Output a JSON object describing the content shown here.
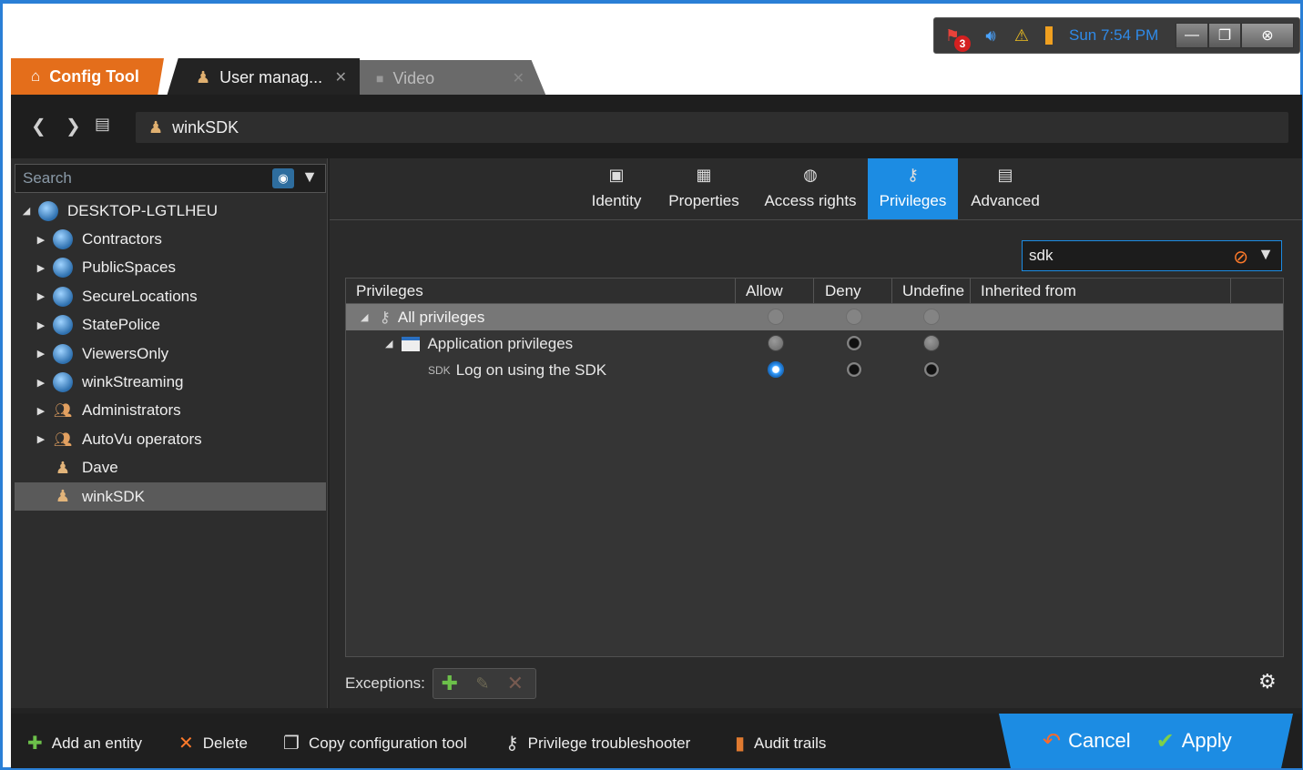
{
  "tray": {
    "alarm_count": "3",
    "clock": "Sun 7:54 PM"
  },
  "tabs": {
    "home_label": "Config Tool",
    "user_label": "User manag...",
    "video_label": "Video"
  },
  "breadcrumb": {
    "current": "winkSDK"
  },
  "left": {
    "search_placeholder": "Search",
    "root": "DESKTOP-LGTLHEU",
    "items": [
      {
        "label": "Contractors",
        "icon": "globe"
      },
      {
        "label": "PublicSpaces",
        "icon": "globe"
      },
      {
        "label": "SecureLocations",
        "icon": "globe"
      },
      {
        "label": "StatePolice",
        "icon": "globe"
      },
      {
        "label": "ViewersOnly",
        "icon": "globe"
      },
      {
        "label": "winkStreaming",
        "icon": "globe"
      },
      {
        "label": "Administrators",
        "icon": "group"
      },
      {
        "label": "AutoVu operators",
        "icon": "group"
      },
      {
        "label": "Dave",
        "icon": "person"
      },
      {
        "label": "winkSDK",
        "icon": "person",
        "selected": true
      }
    ]
  },
  "panel_tabs": [
    {
      "label": "Identity",
      "icon": "identity-icon"
    },
    {
      "label": "Properties",
      "icon": "properties-icon"
    },
    {
      "label": "Access rights",
      "icon": "access-rights-icon"
    },
    {
      "label": "Privileges",
      "icon": "privileges-icon",
      "active": true
    },
    {
      "label": "Advanced",
      "icon": "advanced-icon"
    }
  ],
  "filter": {
    "value": "sdk"
  },
  "grid": {
    "headers": {
      "privileges": "Privileges",
      "allow": "Allow",
      "deny": "Deny",
      "undefine": "Undefine",
      "inherited": "Inherited from"
    },
    "rows": [
      {
        "label": "All privileges",
        "allow": "dim",
        "deny": "dim",
        "undefine": "dim"
      },
      {
        "label": "Application privileges",
        "allow": "off",
        "deny": "black",
        "undefine": "off"
      },
      {
        "prefix": "SDK",
        "label": "Log on using the SDK",
        "allow": "on",
        "deny": "black",
        "undefine": "black"
      }
    ]
  },
  "exceptions": {
    "label": "Exceptions:"
  },
  "bottom": {
    "add_entity": "Add an entity",
    "delete": "Delete",
    "copy_config": "Copy configuration tool",
    "troubleshooter": "Privilege troubleshooter",
    "audit": "Audit trails",
    "cancel": "Cancel",
    "apply": "Apply"
  },
  "colors": {
    "accent": "#1c8ce3",
    "home_tab": "#e46e1b"
  }
}
